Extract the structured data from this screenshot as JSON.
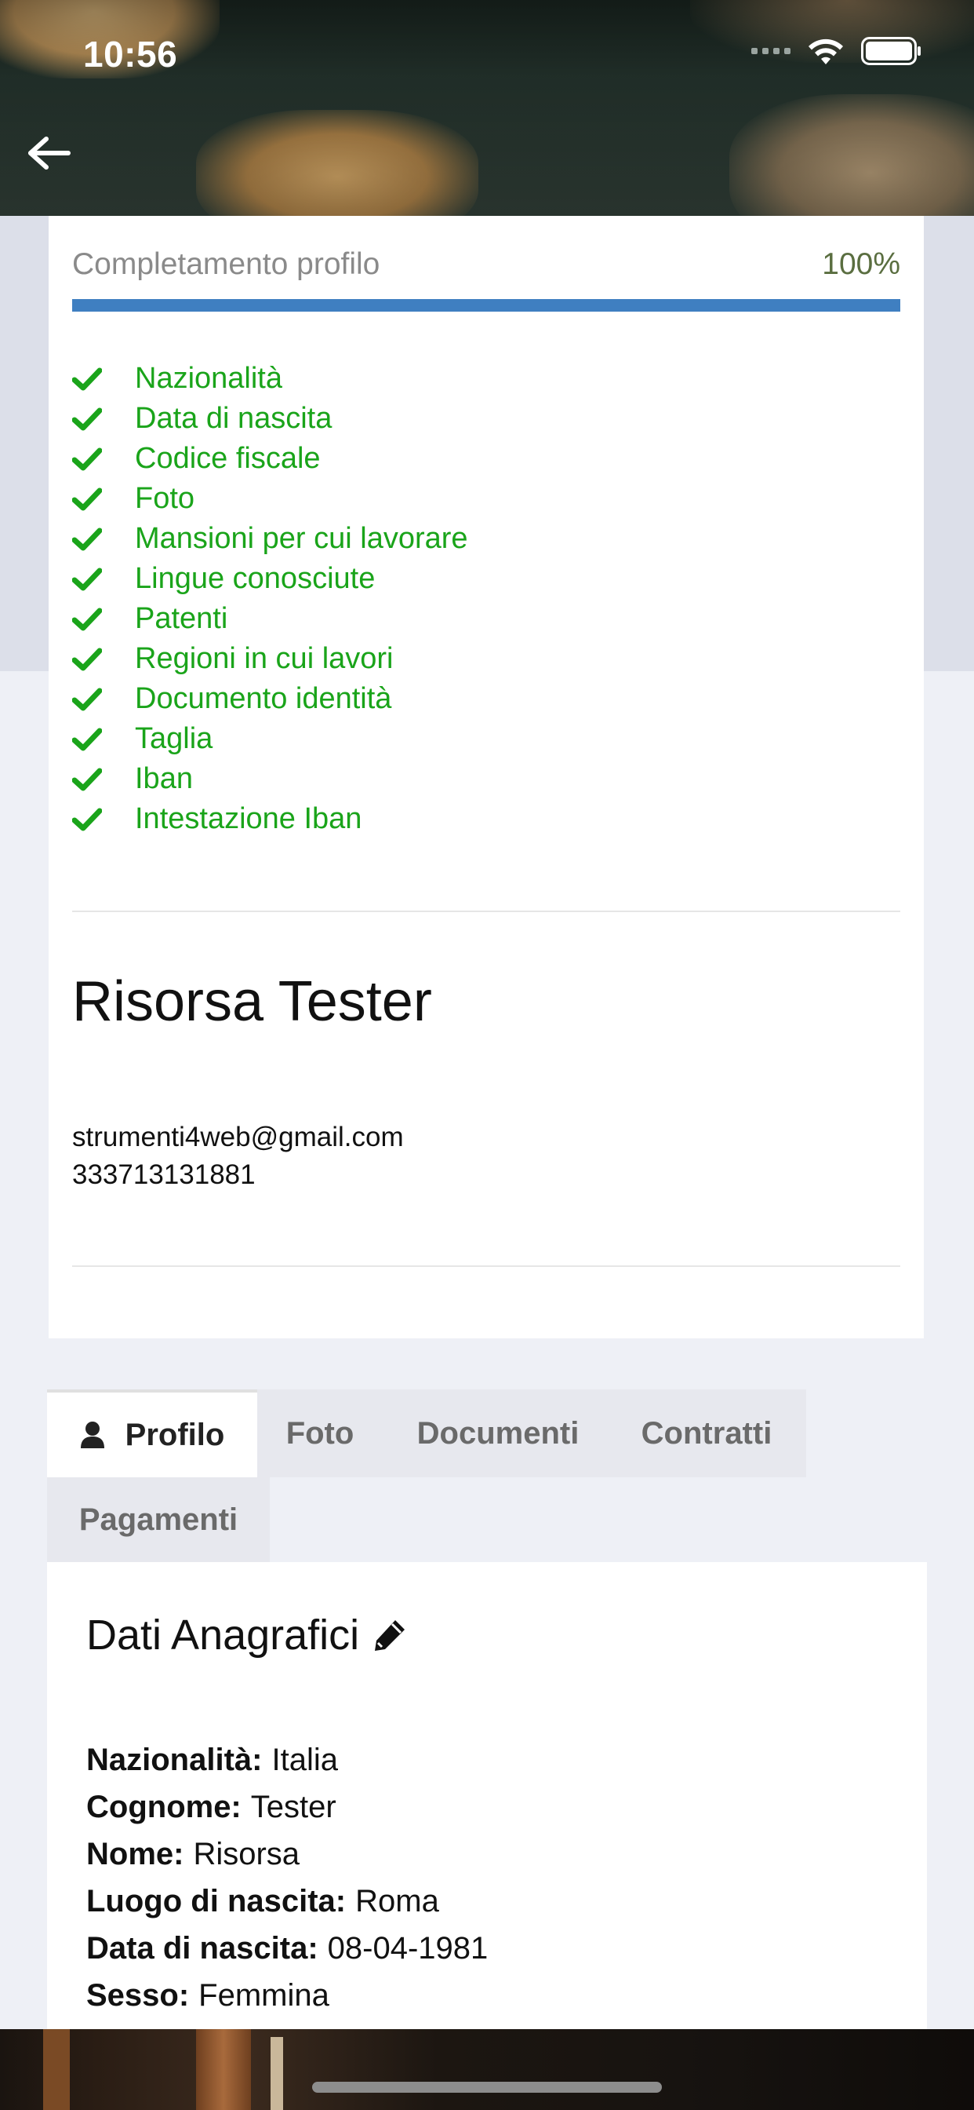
{
  "status_bar": {
    "time": "10:56"
  },
  "profile_completion": {
    "label": "Completamento profilo",
    "value_text": "100%",
    "fraction": 1.0,
    "bar_color": "#3f7fc1"
  },
  "checklist": {
    "check_color": "#1aa41a",
    "items": [
      "Nazionalità",
      "Data di nascita",
      "Codice fiscale",
      "Foto",
      "Mansioni per cui lavorare",
      "Lingue conosciute",
      "Patenti",
      "Regioni in cui lavori",
      "Documento identità",
      "Taglia",
      "Iban",
      "Intestazione Iban"
    ]
  },
  "user": {
    "name": "Risorsa Tester",
    "email": "strumenti4web@gmail.com",
    "phone": "333713131881"
  },
  "tabs": [
    {
      "label": "Profilo",
      "icon": "user-icon",
      "active": true
    },
    {
      "label": "Foto"
    },
    {
      "label": "Documenti"
    },
    {
      "label": "Contratti"
    },
    {
      "label": "Pagamenti"
    }
  ],
  "section": {
    "title": "Dati Anagrafici",
    "edit_icon": "pencil-icon",
    "fields": [
      {
        "key": "Nazionalità:",
        "value": "Italia"
      },
      {
        "key": "Cognome:",
        "value": "Tester"
      },
      {
        "key": "Nome:",
        "value": "Risorsa"
      },
      {
        "key": "Luogo di nascita:",
        "value": "Roma"
      },
      {
        "key": "Data di nascita:",
        "value": "08-04-1981"
      },
      {
        "key": "Sesso:",
        "value": "Femmina"
      }
    ]
  }
}
